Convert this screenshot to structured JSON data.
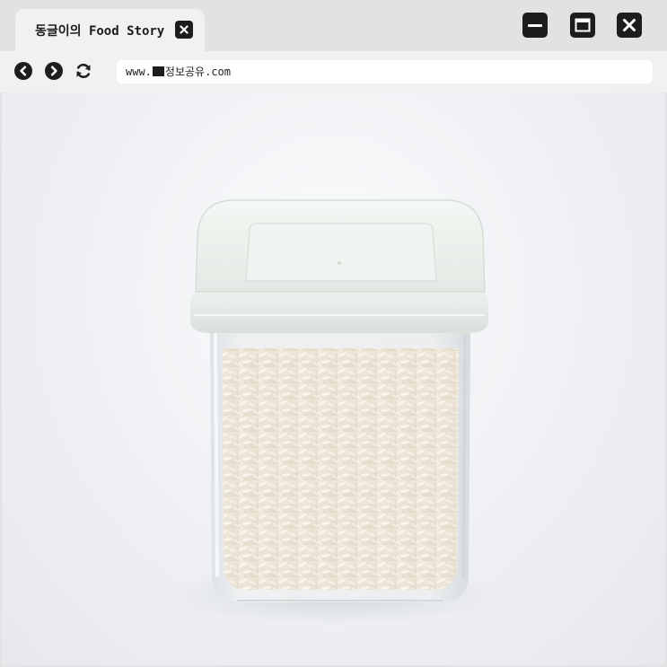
{
  "tab": {
    "title": "동글이의 Food Story"
  },
  "address": {
    "url_prefix": "www.",
    "url_suffix": "정보공유.com"
  },
  "icons": {
    "tab_close": "close-icon",
    "minimize": "minimize-icon",
    "maximize": "maximize-icon",
    "close": "close-icon",
    "back": "back-arrow-icon",
    "forward": "forward-arrow-icon",
    "reload": "reload-icon",
    "url_mark": "redaction-block-icon"
  },
  "colors": {
    "chrome": "#e2e2e2",
    "tab": "#f1f1f1",
    "icon": "#1d1d1d"
  }
}
